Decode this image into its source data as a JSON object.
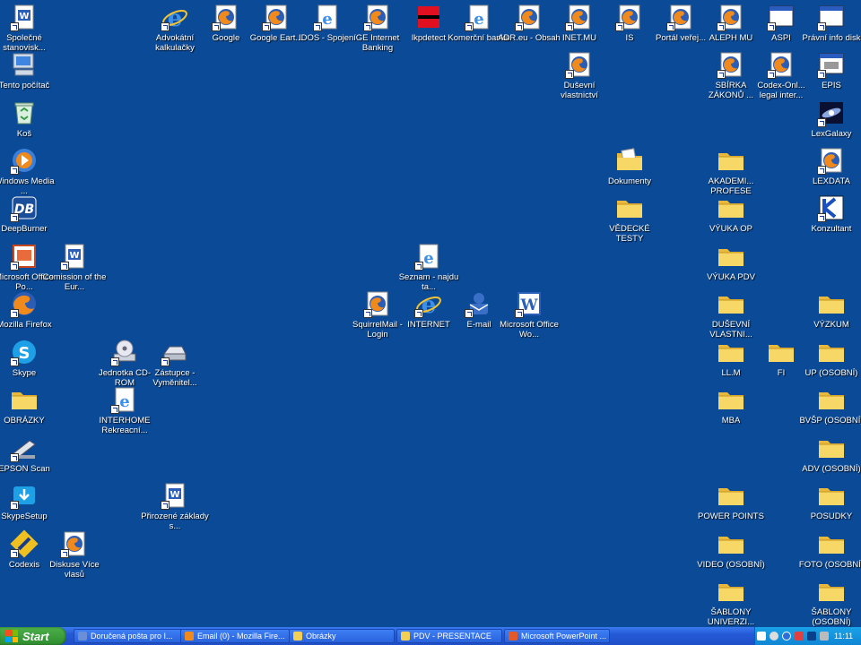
{
  "desktop_icons": [
    {
      "label": "Společné stanovisk...",
      "icon": "word-doc-icon",
      "shortcut": true
    },
    {
      "label": "Tento počítač",
      "icon": "my-computer-icon",
      "shortcut": false
    },
    {
      "label": "Koš",
      "icon": "recycle-bin-icon",
      "shortcut": false
    },
    {
      "label": "Windows Media ...",
      "icon": "media-player-icon",
      "shortcut": true
    },
    {
      "label": "DeepBurner",
      "icon": "deepburner-icon",
      "shortcut": true
    },
    {
      "label": "Microsoft Office Po...",
      "icon": "powerpoint-icon",
      "shortcut": true
    },
    {
      "label": "Comission of the Eur...",
      "icon": "word-doc-icon",
      "shortcut": true
    },
    {
      "label": "Mozilla Firefox",
      "icon": "firefox-icon",
      "shortcut": true
    },
    {
      "label": "Skype",
      "icon": "skype-icon",
      "shortcut": true
    },
    {
      "label": "Jednotka CD-ROM",
      "icon": "cd-drive-icon",
      "shortcut": true
    },
    {
      "label": "Zástupce - Vyměnitel...",
      "icon": "removable-drive-icon",
      "shortcut": true
    },
    {
      "label": "OBRÁZKY",
      "icon": "folder-icon",
      "shortcut": false
    },
    {
      "label": "INTERHOME Rekreacní...",
      "icon": "web-page-icon",
      "shortcut": true
    },
    {
      "label": "EPSON Scan",
      "icon": "scanner-icon",
      "shortcut": true
    },
    {
      "label": "SkypeSetup",
      "icon": "skype-setup-icon",
      "shortcut": true
    },
    {
      "label": "Přirozené základy s...",
      "icon": "word-doc-icon",
      "shortcut": true
    },
    {
      "label": "Codexis",
      "icon": "codexis-icon",
      "shortcut": true
    },
    {
      "label": "Diskuse Více vlasů",
      "icon": "firefox-page-icon",
      "shortcut": true
    },
    {
      "label": "Advokátní kalkulačky",
      "icon": "ie-icon",
      "shortcut": true
    },
    {
      "label": "Google",
      "icon": "firefox-page-icon",
      "shortcut": true
    },
    {
      "label": "Google Eart...",
      "icon": "firefox-page-icon",
      "shortcut": true
    },
    {
      "label": "IDOS - Spojení",
      "icon": "web-page-icon",
      "shortcut": true
    },
    {
      "label": "GE Internet Banking",
      "icon": "firefox-page-icon",
      "shortcut": true
    },
    {
      "label": "lkpdetect",
      "icon": "lkpdetect-icon",
      "shortcut": false
    },
    {
      "label": "Komerční banka",
      "icon": "web-page-icon",
      "shortcut": true
    },
    {
      "label": "ADR.eu - Obsah",
      "icon": "firefox-page-icon",
      "shortcut": true
    },
    {
      "label": "INET.MU",
      "icon": "firefox-page-icon",
      "shortcut": true
    },
    {
      "label": "IS",
      "icon": "firefox-page-icon",
      "shortcut": true
    },
    {
      "label": "Portál veřej...",
      "icon": "firefox-page-icon",
      "shortcut": true
    },
    {
      "label": "ALEPH MU",
      "icon": "firefox-page-icon",
      "shortcut": true
    },
    {
      "label": "ASPI",
      "icon": "window-app-icon",
      "shortcut": true
    },
    {
      "label": "Právní info disk",
      "icon": "window-app-icon",
      "shortcut": true
    },
    {
      "label": "Duševní vlastnictví",
      "icon": "firefox-page-icon",
      "shortcut": true
    },
    {
      "label": "SBÍRKA ZÁKONŮ ...",
      "icon": "firefox-page-icon",
      "shortcut": true
    },
    {
      "label": "Codex-Onl... legal inter...",
      "icon": "firefox-page-icon",
      "shortcut": true
    },
    {
      "label": "EPIS",
      "icon": "epis-icon",
      "shortcut": true
    },
    {
      "label": "LexGalaxy",
      "icon": "lexgalaxy-icon",
      "shortcut": true
    },
    {
      "label": "Dokumenty",
      "icon": "documents-folder-icon",
      "shortcut": false
    },
    {
      "label": "AKADEMI... PROFESE",
      "icon": "folder-icon",
      "shortcut": false
    },
    {
      "label": "LEXDATA",
      "icon": "firefox-page-icon",
      "shortcut": true
    },
    {
      "label": "VĚDECKÉ TESTY",
      "icon": "folder-icon",
      "shortcut": false
    },
    {
      "label": "VÝUKA OP",
      "icon": "folder-icon",
      "shortcut": false
    },
    {
      "label": "Konzultant",
      "icon": "konzultant-icon",
      "shortcut": true
    },
    {
      "label": "Seznam - najdu ta...",
      "icon": "web-page-icon",
      "shortcut": true
    },
    {
      "label": "VÝUKA PDV",
      "icon": "folder-icon",
      "shortcut": false
    },
    {
      "label": "SquirrelMail - Login",
      "icon": "firefox-page-icon",
      "shortcut": true
    },
    {
      "label": "INTERNET",
      "icon": "ie-icon",
      "shortcut": true
    },
    {
      "label": "E-mail",
      "icon": "email-icon",
      "shortcut": true
    },
    {
      "label": "Microsoft Office Wo...",
      "icon": "word-icon",
      "shortcut": true
    },
    {
      "label": "DUŠEVNÍ VLASTNI...",
      "icon": "folder-icon",
      "shortcut": false
    },
    {
      "label": "VÝZKUM",
      "icon": "folder-icon",
      "shortcut": false
    },
    {
      "label": "LL.M",
      "icon": "folder-icon",
      "shortcut": false
    },
    {
      "label": "FI",
      "icon": "folder-icon",
      "shortcut": false
    },
    {
      "label": "UP (OSOBNÍ)",
      "icon": "folder-icon",
      "shortcut": false
    },
    {
      "label": "MBA",
      "icon": "folder-icon",
      "shortcut": false
    },
    {
      "label": "BVŠP (OSOBNÍ)",
      "icon": "folder-icon",
      "shortcut": false
    },
    {
      "label": "ADV (OSOBNÍ)",
      "icon": "folder-icon",
      "shortcut": false
    },
    {
      "label": "POWER POINTS",
      "icon": "folder-icon",
      "shortcut": false
    },
    {
      "label": "POSUDKY",
      "icon": "folder-icon",
      "shortcut": false
    },
    {
      "label": "VIDEO (OSOBNÍ)",
      "icon": "folder-icon",
      "shortcut": false
    },
    {
      "label": "FOTO (OSOBNÍ)",
      "icon": "folder-icon",
      "shortcut": false
    },
    {
      "label": "ŠABLONY UNIVERZI...",
      "icon": "folder-icon",
      "shortcut": false
    },
    {
      "label": "ŠABLONY (OSOBNÍ)",
      "icon": "folder-icon",
      "shortcut": false
    }
  ],
  "taskbar": {
    "start_label": "Start",
    "tasks": [
      {
        "label": "Doručená pošta pro I...",
        "icon": "email-icon"
      },
      {
        "label": "Email (0) - Mozilla Fire...",
        "icon": "firefox-icon"
      },
      {
        "label": "Obrázky",
        "icon": "folder-icon"
      },
      {
        "label": "PDV - PRESENTACE",
        "icon": "folder-icon"
      },
      {
        "label": "Microsoft PowerPoint ...",
        "icon": "powerpoint-icon"
      }
    ],
    "language": "CS",
    "clock": "11:11"
  },
  "colors": {
    "desktop": "#0b4a97",
    "folder": "#f3cf55",
    "taskbar": "#2459d6",
    "start": "#3a9a38",
    "tray": "#1496de"
  }
}
